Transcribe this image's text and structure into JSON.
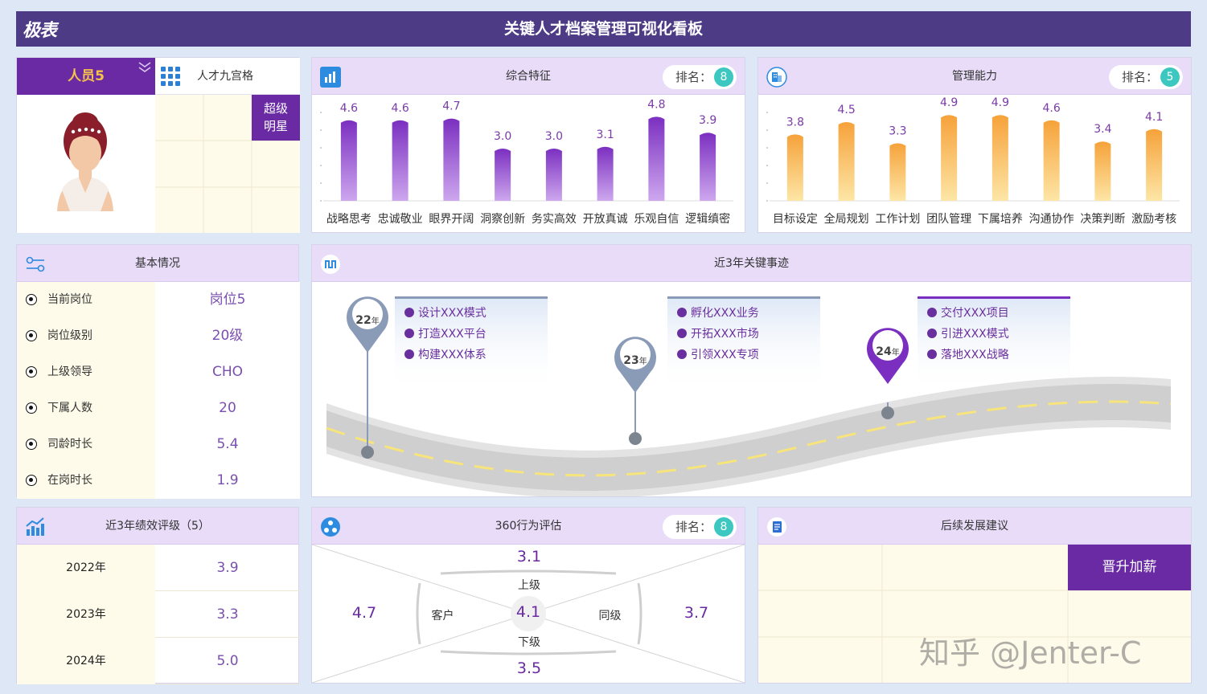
{
  "header": {
    "logo_text": "极表",
    "title": "关键人才档案管理可视化看板"
  },
  "person": {
    "name": "人员5",
    "grid_title": "人才九宫格",
    "grid_tag": "超级明星",
    "grid_tag_l1": "超级",
    "grid_tag_l2": "明星"
  },
  "overall": {
    "title": "综合特征",
    "rank_label": "排名：",
    "rank": "8",
    "chart_data": {
      "type": "bar",
      "categories": [
        "战略思考",
        "忠诚敬业",
        "眼界开阔",
        "洞察创新",
        "务实高效",
        "开放真诚",
        "乐观自信",
        "逻辑缜密"
      ],
      "values": [
        4.6,
        4.6,
        4.7,
        3.0,
        3.0,
        3.1,
        4.8,
        3.9
      ],
      "labels": [
        "4.6",
        "4.6",
        "4.7",
        "3.0",
        "3.0",
        "3.1",
        "4.8",
        "3.9"
      ],
      "ylim": [
        0,
        5
      ],
      "color": "#7b2fc0"
    }
  },
  "management": {
    "title": "管理能力",
    "rank_label": "排名：",
    "rank": "5",
    "chart_data": {
      "type": "bar",
      "categories": [
        "目标设定",
        "全局规划",
        "工作计划",
        "团队管理",
        "下属培养",
        "沟通协作",
        "决策判断",
        "激励考核"
      ],
      "values": [
        3.8,
        4.5,
        3.3,
        4.9,
        4.9,
        4.6,
        3.4,
        4.1
      ],
      "labels": [
        "3.8",
        "4.5",
        "3.3",
        "4.9",
        "4.9",
        "4.6",
        "3.4",
        "4.1"
      ],
      "ylim": [
        0,
        5
      ],
      "color": "#f7a93a"
    }
  },
  "basic": {
    "title": "基本情况",
    "rows": [
      {
        "k": "当前岗位",
        "v": "岗位5"
      },
      {
        "k": "岗位级别",
        "v": "20级"
      },
      {
        "k": "上级领导",
        "v": "CHO"
      },
      {
        "k": "下属人数",
        "v": "20"
      },
      {
        "k": "司龄时长",
        "v": "5.4"
      },
      {
        "k": "在岗时长",
        "v": "1.9"
      }
    ]
  },
  "events": {
    "title": "近3年关键事迹",
    "years": [
      {
        "num": "22",
        "unit": "年",
        "items": [
          "设计XXX模式",
          "打造XXX平台",
          "构建XXX体系"
        ]
      },
      {
        "num": "23",
        "unit": "年",
        "items": [
          "孵化XXX业务",
          "开拓XXX市场",
          "引领XXX专项"
        ]
      },
      {
        "num": "24",
        "unit": "年",
        "items": [
          "交付XXX项目",
          "引进XXX模式",
          "落地XXX战略"
        ]
      }
    ]
  },
  "performance": {
    "title": "近3年绩效评级（5）",
    "rows": [
      {
        "year": "2022年",
        "score": "3.9"
      },
      {
        "year": "2023年",
        "score": "3.3"
      },
      {
        "year": "2024年",
        "score": "5.0"
      }
    ]
  },
  "eval360": {
    "title": "360行为评估",
    "rank_label": "排名：",
    "rank": "8",
    "top_val": "3.1",
    "top_lbl": "上级",
    "left_val": "4.7",
    "left_lbl": "客户",
    "center_val": "4.1",
    "right_lbl": "同级",
    "right_val": "3.7",
    "bottom_lbl": "下级",
    "bottom_val": "3.5"
  },
  "advice": {
    "title": "后续发展建议",
    "tag": "晋升加薪"
  },
  "watermark": "知乎 @Jenter-C"
}
